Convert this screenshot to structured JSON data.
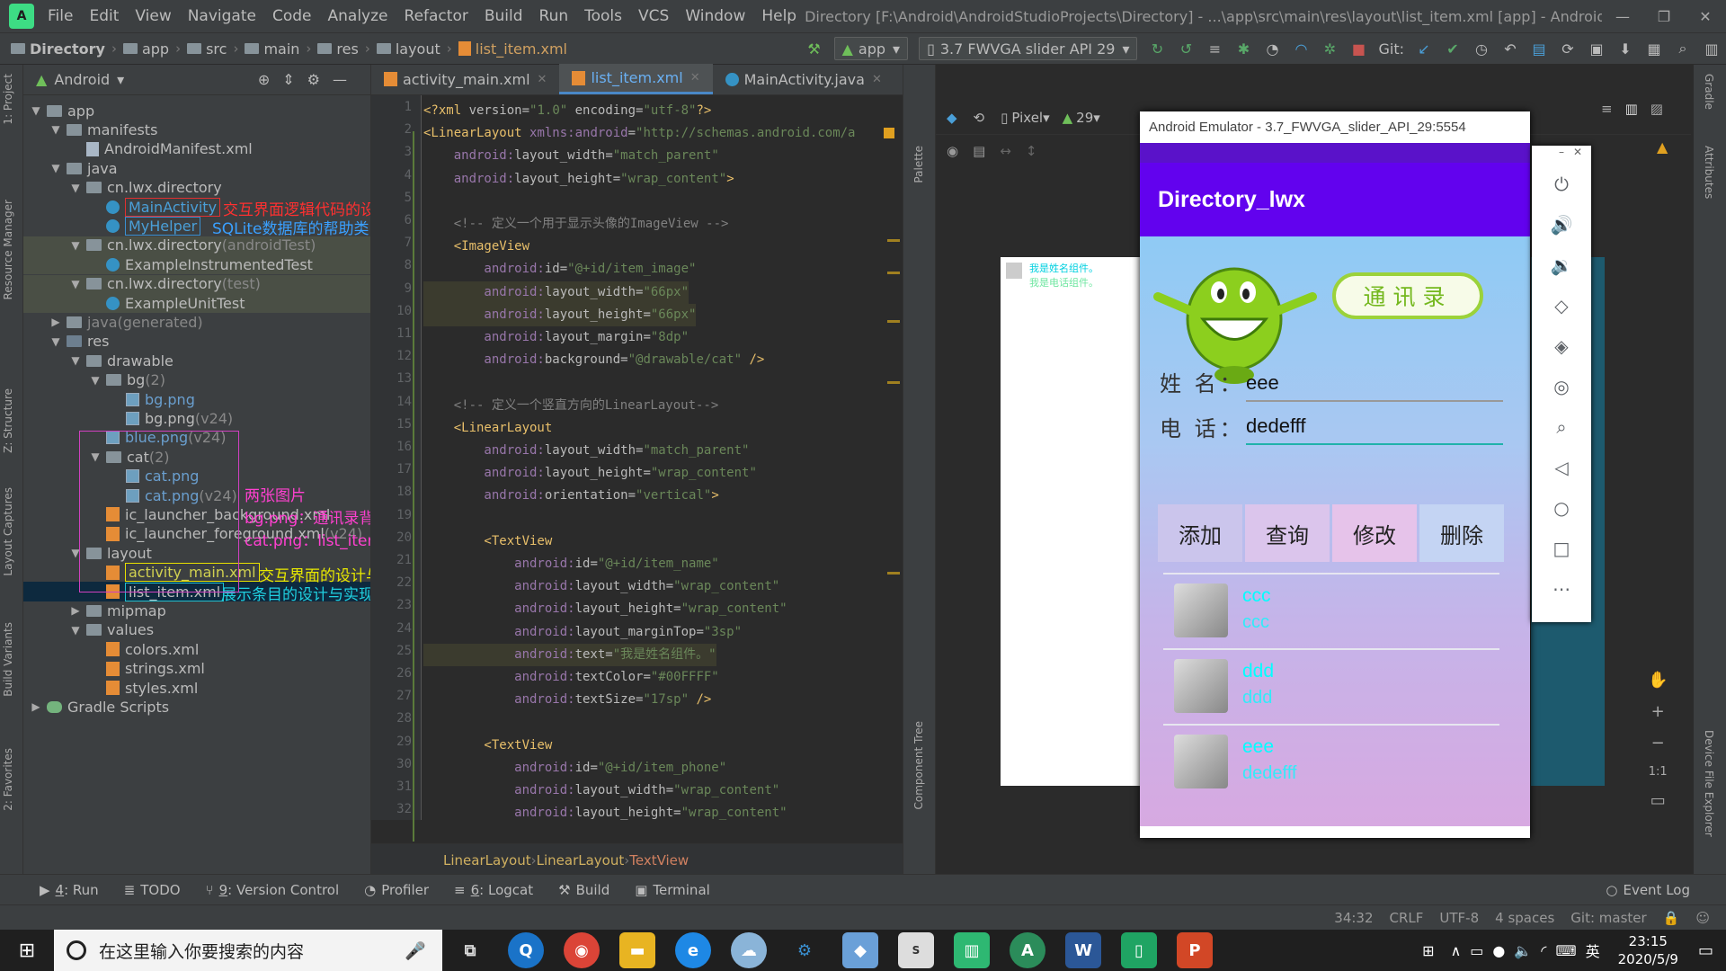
{
  "window": {
    "title": "Directory [F:\\Android\\AndroidStudioProjects\\Directory] - ...\\app\\src\\main\\res\\layout\\list_item.xml [app] - Android Studio",
    "menu": [
      "File",
      "Edit",
      "View",
      "Navigate",
      "Code",
      "Analyze",
      "Refactor",
      "Build",
      "Run",
      "Tools",
      "VCS",
      "Window",
      "Help"
    ]
  },
  "breadcrumb": [
    "Directory",
    "app",
    "src",
    "main",
    "res",
    "layout",
    "list_item.xml"
  ],
  "toolbar": {
    "config": "app",
    "device": "3.7  FWVGA slider API 29",
    "git": "Git:"
  },
  "project": {
    "view": "Android",
    "tree": [
      {
        "label": "app",
        "indent": 0,
        "tw": "▼",
        "icon": "folder"
      },
      {
        "label": "manifests",
        "indent": 1,
        "tw": "▼",
        "icon": "folder"
      },
      {
        "label": "AndroidManifest.xml",
        "indent": 2,
        "tw": "",
        "icon": "file"
      },
      {
        "label": "java",
        "indent": 1,
        "tw": "▼",
        "icon": "folder"
      },
      {
        "label": "cn.lwx.directory",
        "indent": 2,
        "tw": "▼",
        "icon": "folder"
      },
      {
        "label": "MainActivity",
        "indent": 3,
        "tw": "",
        "icon": "java",
        "color": "#4a9fd8",
        "box": "#e03030"
      },
      {
        "label": "MyHelper",
        "indent": 3,
        "tw": "",
        "icon": "java",
        "color": "#4a9fd8",
        "box": "#3a8fd0"
      },
      {
        "label": "cn.lwx.directory",
        "suffix": " (androidTest)",
        "indent": 2,
        "tw": "▼",
        "icon": "folder",
        "hl": true
      },
      {
        "label": "ExampleInstrumentedTest",
        "indent": 3,
        "tw": "",
        "icon": "java",
        "hl": true
      },
      {
        "label": "cn.lwx.directory",
        "suffix": " (test)",
        "indent": 2,
        "tw": "▼",
        "icon": "folder",
        "hl": true
      },
      {
        "label": "ExampleUnitTest",
        "indent": 3,
        "tw": "",
        "icon": "java",
        "hl": true
      },
      {
        "label": "java",
        "suffix": " (generated)",
        "indent": 1,
        "tw": "▶",
        "icon": "folder",
        "dim": true
      },
      {
        "label": "res",
        "indent": 1,
        "tw": "▼",
        "icon": "res"
      },
      {
        "label": "drawable",
        "indent": 2,
        "tw": "▼",
        "icon": "folder"
      },
      {
        "label": "bg",
        "suffix": " (2)",
        "indent": 3,
        "tw": "▼",
        "icon": "folder"
      },
      {
        "label": "bg.png",
        "indent": 4,
        "tw": "",
        "icon": "img",
        "color": "#6a9fcf"
      },
      {
        "label": "bg.png",
        "suffix": " (v24)",
        "indent": 4,
        "tw": "",
        "icon": "img"
      },
      {
        "label": "blue.png",
        "suffix": " (v24)",
        "indent": 3,
        "tw": "",
        "icon": "img",
        "color": "#6a9fcf"
      },
      {
        "label": "cat",
        "suffix": " (2)",
        "indent": 3,
        "tw": "▼",
        "icon": "folder"
      },
      {
        "label": "cat.png",
        "indent": 4,
        "tw": "",
        "icon": "img",
        "color": "#6a9fcf"
      },
      {
        "label": "cat.png",
        "suffix": " (v24)",
        "indent": 4,
        "tw": "",
        "icon": "img",
        "color": "#6a9fcf"
      },
      {
        "label": "ic_launcher_background.xml",
        "indent": 3,
        "tw": "",
        "icon": "xml"
      },
      {
        "label": "ic_launcher_foreground.xml",
        "suffix": " (v24)",
        "indent": 3,
        "tw": "",
        "icon": "xml"
      },
      {
        "label": "layout",
        "indent": 2,
        "tw": "▼",
        "icon": "folder"
      },
      {
        "label": "activity_main.xml",
        "indent": 3,
        "tw": "",
        "icon": "xml",
        "color": "#d0d050",
        "box": "#e8e000"
      },
      {
        "label": "list_item.xml",
        "indent": 3,
        "tw": "",
        "icon": "xml",
        "selected": true,
        "box": "#20c0d0"
      },
      {
        "label": "mipmap",
        "indent": 2,
        "tw": "▶",
        "icon": "folder"
      },
      {
        "label": "values",
        "indent": 2,
        "tw": "▼",
        "icon": "folder"
      },
      {
        "label": "colors.xml",
        "indent": 3,
        "tw": "",
        "icon": "xml"
      },
      {
        "label": "strings.xml",
        "indent": 3,
        "tw": "",
        "icon": "xml"
      },
      {
        "label": "styles.xml",
        "indent": 3,
        "tw": "",
        "icon": "xml"
      },
      {
        "label": "Gradle Scripts",
        "indent": 0,
        "tw": "▶",
        "icon": "gradle"
      }
    ]
  },
  "notes": [
    {
      "text": "交互界面逻辑代码的设计与实现",
      "color": "#ff3030",
      "row": 5
    },
    {
      "text": "SQLite数据库的帮助类",
      "color": "#3aa0ff",
      "row": 6
    },
    {
      "text": "交互界面的设计与实现",
      "color": "#e8e800",
      "row": 24
    },
    {
      "text": "展示条目的设计与实现",
      "color": "#20d0e0",
      "row": 25
    }
  ],
  "drawable_note": [
    "两张图片",
    "bg.png：通讯录背景图",
    "cat.png：list_item.xml条目布局的头像"
  ],
  "editor": {
    "tabs": [
      {
        "label": "activity_main.xml",
        "icon": "xml"
      },
      {
        "label": "list_item.xml",
        "icon": "xml",
        "active": true
      },
      {
        "label": "MainActivity.java",
        "icon": "java"
      }
    ],
    "lines": [
      [
        [
          "<?",
          "#e8bf6a"
        ],
        [
          "xml ",
          "#e8bf6a"
        ],
        [
          "version",
          "#bababa"
        ],
        [
          "=",
          "#bababa"
        ],
        [
          "\"1.0\" ",
          "#6a8759"
        ],
        [
          "encoding",
          "#bababa"
        ],
        [
          "=",
          "#bababa"
        ],
        [
          "\"utf-8\"",
          "#6a8759"
        ],
        [
          "?>",
          "#e8bf6a"
        ]
      ],
      [
        [
          "<LinearLayout ",
          "#e8bf6a"
        ],
        [
          "xmlns:",
          "#9876aa"
        ],
        [
          "android",
          "#9876aa"
        ],
        [
          "=",
          "#bababa"
        ],
        [
          "\"http://schemas.android.com/a",
          "#6a8759"
        ]
      ],
      [
        [
          "    android:",
          "#9876aa"
        ],
        [
          "layout_width",
          "#bababa"
        ],
        [
          "=",
          "#bababa"
        ],
        [
          "\"match_parent\"",
          "#6a8759"
        ]
      ],
      [
        [
          "    android:",
          "#9876aa"
        ],
        [
          "layout_height",
          "#bababa"
        ],
        [
          "=",
          "#bababa"
        ],
        [
          "\"wrap_content\"",
          "#6a8759"
        ],
        [
          ">",
          "#e8bf6a"
        ]
      ],
      [
        [
          "",
          ""
        ]
      ],
      [
        [
          "    <!-- 定义一个用于显示头像的ImageView -->",
          "#808080"
        ]
      ],
      [
        [
          "    <ImageView",
          "#e8bf6a"
        ]
      ],
      [
        [
          "        android:",
          "#9876aa"
        ],
        [
          "id",
          "#bababa"
        ],
        [
          "=",
          "#bababa"
        ],
        [
          "\"@+id/item_image\"",
          "#6a8759"
        ]
      ],
      [
        [
          "        android:",
          "#9876aa"
        ],
        [
          "layout_width",
          "#bababa"
        ],
        [
          "=",
          "#bababa"
        ],
        [
          "\"66px\"",
          "#6a8759"
        ]
      ],
      [
        [
          "        android:",
          "#9876aa"
        ],
        [
          "layout_height",
          "#bababa"
        ],
        [
          "=",
          "#bababa"
        ],
        [
          "\"66px\"",
          "#6a8759"
        ]
      ],
      [
        [
          "        android:",
          "#9876aa"
        ],
        [
          "layout_margin",
          "#bababa"
        ],
        [
          "=",
          "#bababa"
        ],
        [
          "\"8dp\"",
          "#6a8759"
        ]
      ],
      [
        [
          "        android:",
          "#9876aa"
        ],
        [
          "background",
          "#bababa"
        ],
        [
          "=",
          "#bababa"
        ],
        [
          "\"@drawable/cat\" ",
          "#6a8759"
        ],
        [
          "/>",
          "#e8bf6a"
        ]
      ],
      [
        [
          "",
          ""
        ]
      ],
      [
        [
          "    <!-- 定义一个竖直方向的LinearLayout-->",
          "#808080"
        ]
      ],
      [
        [
          "    <LinearLayout",
          "#e8bf6a"
        ]
      ],
      [
        [
          "        android:",
          "#9876aa"
        ],
        [
          "layout_width",
          "#bababa"
        ],
        [
          "=",
          "#bababa"
        ],
        [
          "\"match_parent\"",
          "#6a8759"
        ]
      ],
      [
        [
          "        android:",
          "#9876aa"
        ],
        [
          "layout_height",
          "#bababa"
        ],
        [
          "=",
          "#bababa"
        ],
        [
          "\"wrap_content\"",
          "#6a8759"
        ]
      ],
      [
        [
          "        android:",
          "#9876aa"
        ],
        [
          "orientation",
          "#bababa"
        ],
        [
          "=",
          "#bababa"
        ],
        [
          "\"vertical\"",
          "#6a8759"
        ],
        [
          ">",
          "#e8bf6a"
        ]
      ],
      [
        [
          "",
          ""
        ]
      ],
      [
        [
          "        <TextView",
          "#e8bf6a"
        ]
      ],
      [
        [
          "            android:",
          "#9876aa"
        ],
        [
          "id",
          "#bababa"
        ],
        [
          "=",
          "#bababa"
        ],
        [
          "\"@+id/item_name\"",
          "#6a8759"
        ]
      ],
      [
        [
          "            android:",
          "#9876aa"
        ],
        [
          "layout_width",
          "#bababa"
        ],
        [
          "=",
          "#bababa"
        ],
        [
          "\"wrap_content\"",
          "#6a8759"
        ]
      ],
      [
        [
          "            android:",
          "#9876aa"
        ],
        [
          "layout_height",
          "#bababa"
        ],
        [
          "=",
          "#bababa"
        ],
        [
          "\"wrap_content\"",
          "#6a8759"
        ]
      ],
      [
        [
          "            android:",
          "#9876aa"
        ],
        [
          "layout_marginTop",
          "#bababa"
        ],
        [
          "=",
          "#bababa"
        ],
        [
          "\"3sp\"",
          "#6a8759"
        ]
      ],
      [
        [
          "            android:",
          "#9876aa"
        ],
        [
          "text",
          "#bababa"
        ],
        [
          "=",
          "#bababa"
        ],
        [
          "\"我是姓名组件。\"",
          "#6a8759"
        ]
      ],
      [
        [
          "            android:",
          "#9876aa"
        ],
        [
          "textColor",
          "#bababa"
        ],
        [
          "=",
          "#bababa"
        ],
        [
          "\"#00FFFF\"",
          "#6a8759"
        ]
      ],
      [
        [
          "            android:",
          "#9876aa"
        ],
        [
          "textSize",
          "#bababa"
        ],
        [
          "=",
          "#bababa"
        ],
        [
          "\"17sp\" ",
          "#6a8759"
        ],
        [
          "/>",
          "#e8bf6a"
        ]
      ],
      [
        [
          "",
          ""
        ]
      ],
      [
        [
          "        <TextView",
          "#e8bf6a"
        ]
      ],
      [
        [
          "            android:",
          "#9876aa"
        ],
        [
          "id",
          "#bababa"
        ],
        [
          "=",
          "#bababa"
        ],
        [
          "\"@+id/item_phone\"",
          "#6a8759"
        ]
      ],
      [
        [
          "            android:",
          "#9876aa"
        ],
        [
          "layout_width",
          "#bababa"
        ],
        [
          "=",
          "#bababa"
        ],
        [
          "\"wrap_content\"",
          "#6a8759"
        ]
      ],
      [
        [
          "            android:",
          "#9876aa"
        ],
        [
          "layout_height",
          "#bababa"
        ],
        [
          "=",
          "#bababa"
        ],
        [
          "\"wrap_content\"",
          "#6a8759"
        ]
      ]
    ],
    "footer": [
      "LinearLayout",
      "LinearLayout",
      "TextView"
    ]
  },
  "designer": {
    "device": "Pixel",
    "api": "29",
    "preview_name": "我是姓名组件。",
    "preview_phone": "我是电话组件。"
  },
  "emulator": {
    "title": "Android Emulator - 3.7_FWVGA_slider_API_29:5554",
    "app_title": "Directory_lwx",
    "banner": "通讯录",
    "name_label": "姓 名：",
    "name_value": "eee",
    "phone_label": "电 话：",
    "phone_value": "dedefff",
    "buttons": [
      "添加",
      "查询",
      "修改",
      "删除"
    ],
    "button_colors": [
      "#cbc5ec",
      "#dbc5ec",
      "#e6c3ea",
      "#c4d4f3"
    ],
    "items": [
      {
        "name": "ccc",
        "phone": "ccc"
      },
      {
        "name": "ddd",
        "phone": "ddd"
      },
      {
        "name": "eee",
        "phone": "dedefff"
      }
    ]
  },
  "left_tabs": [
    "1: Project",
    "Resource Manager",
    "Z: Structure",
    "Layout Captures",
    "Build Variants",
    "2: Favorites"
  ],
  "right_tabs": [
    "Gradle",
    "Attributes",
    "Device File Explorer"
  ],
  "designer_side": [
    "Palette",
    "Component Tree"
  ],
  "bottom_tools": [
    {
      "n": "4",
      "label": ": Run"
    },
    {
      "n": "",
      "label": "TODO"
    },
    {
      "n": "9",
      "label": ": Version Control"
    },
    {
      "n": "",
      "label": "Profiler"
    },
    {
      "n": "6",
      "label": ": Logcat"
    },
    {
      "n": "",
      "label": "Build"
    },
    {
      "n": "",
      "label": "Terminal"
    }
  ],
  "event_log": "Event Log",
  "status": {
    "position": "34:32",
    "line_sep": "CRLF",
    "encoding": "UTF-8",
    "indent": "4 spaces",
    "git": "Git: master"
  },
  "taskbar": {
    "search": "在这里输入你要搜索的内容",
    "time": "23:15",
    "date": "2020/5/9",
    "ime": "英"
  }
}
